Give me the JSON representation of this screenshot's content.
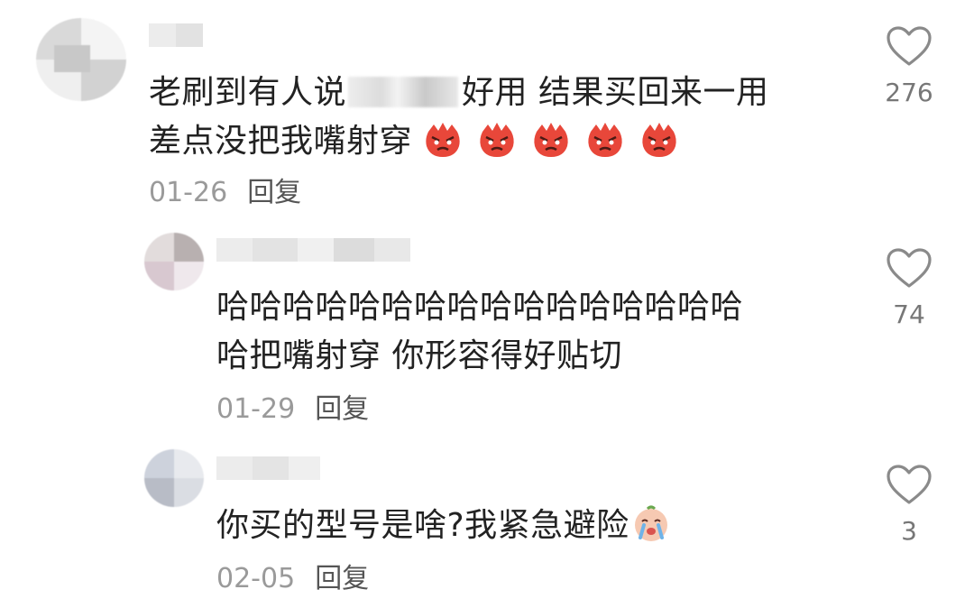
{
  "comments": [
    {
      "text_before": "老刷到有人说",
      "text_after": "好用 结果买回来一用",
      "line2": "差点没把我嘴射穿",
      "date": "01-26",
      "reply": "回复",
      "likes": "276",
      "emoji": "angry-face-icon"
    },
    {
      "line1": "哈哈哈哈哈哈哈哈哈哈哈哈哈哈哈哈",
      "line2": "哈把嘴射穿 你形容得好贴切",
      "date": "01-29",
      "reply": "回复",
      "likes": "74"
    },
    {
      "text": "你买的型号是啥?我紧急避险",
      "date": "02-05",
      "reply": "回复",
      "likes": "3",
      "emoji": "crying-face-icon"
    }
  ],
  "colors": {
    "text": "#222222",
    "meta": "#9a9a9a",
    "reply": "#555555",
    "heart": "#8a8a8a",
    "emoji_red": "#e8473a"
  }
}
